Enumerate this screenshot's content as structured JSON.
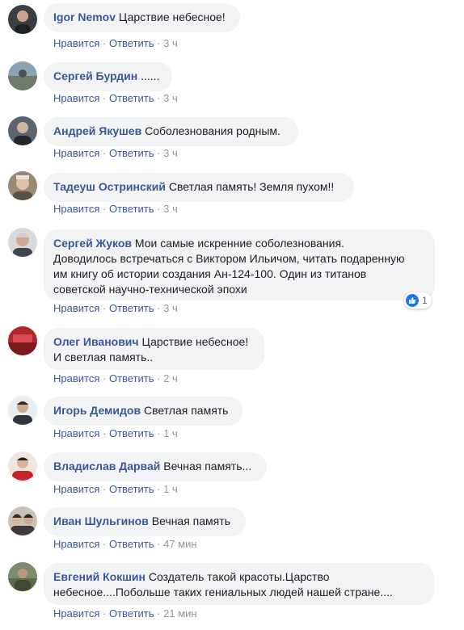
{
  "actions": {
    "like": "Нравится",
    "reply": "Ответить",
    "sep": "·"
  },
  "comments": [
    {
      "author": "Igor Nemov",
      "text": "Царствие небесное!",
      "time": "3 ч"
    },
    {
      "author": "Сергей Бурдин",
      "text": "......",
      "time": "3 ч"
    },
    {
      "author": "Андрей Якушев",
      "text": "Соболезнования родным.",
      "time": "3 ч"
    },
    {
      "author": "Тадеуш Остринский",
      "text": "Светлая память! Земля пухом!!",
      "time": "3 ч"
    },
    {
      "author": "Сергей Жуков",
      "text": "Мои самые искренние соболезнования.",
      "lines": [
        "Доводилось встречаться с Виктором Ильичом, читать подаренную",
        "им книгу об истории создания Ан-124-100. Один из титанов",
        "советской научно-технической эпохи"
      ],
      "time": "3 ч",
      "reaction_count": "1"
    },
    {
      "author": "Олег Иванович",
      "text": "Царствие небесное!",
      "lines": [
        "И светлая память.."
      ],
      "time": "2 ч"
    },
    {
      "author": "Игорь Демидов",
      "text": "Светлая память",
      "time": "1 ч"
    },
    {
      "author": "Владислав Дарвай",
      "text": "Вечная память...",
      "time": "1 ч"
    },
    {
      "author": "Иван Шульгинов",
      "text": "Вечная память",
      "time": "47 мин"
    },
    {
      "author": "Евгений Кокшин",
      "text": "Создатель такой красоты.Царство",
      "lines": [
        "небесное....Побольше таких гениальных людей нашей стране...."
      ],
      "time": "21 мин"
    }
  ],
  "colors": {
    "link": "#385898",
    "bubble": "#f2f3f5",
    "meta": "#90949c",
    "like": "#1877f2"
  }
}
